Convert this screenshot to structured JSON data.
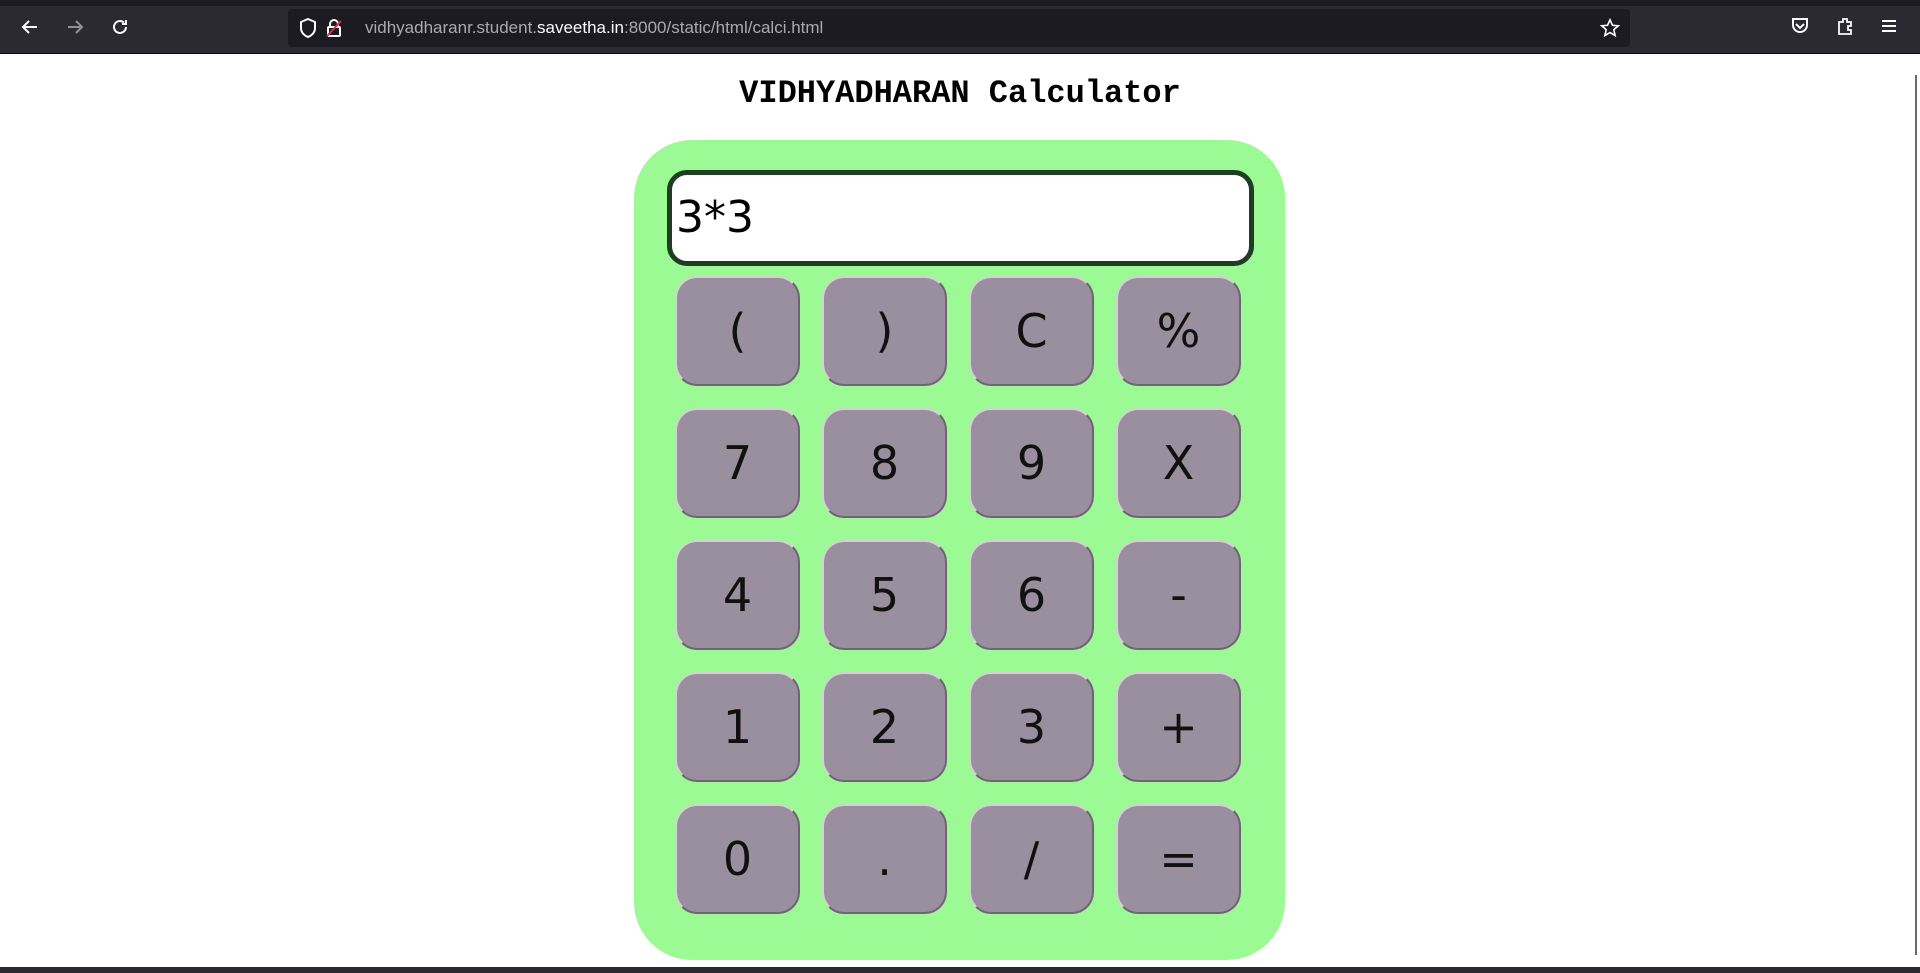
{
  "browser": {
    "url_prefix": "vidhyadharanr.student.",
    "url_host": "saveetha.in",
    "url_suffix": ":8000/static/html/calci.html",
    "icons": [
      "back-icon",
      "forward-icon",
      "reload-icon",
      "shield-icon",
      "lock-icon",
      "bookmark-star-icon",
      "pocket-icon",
      "extensions-icon",
      "menu-icon"
    ]
  },
  "page": {
    "title": "VIDHYADHARAN Calculator"
  },
  "calculator": {
    "display_value": "3*3",
    "colors": {
      "body": "#9cfa94",
      "key": "#9a8f9e",
      "display_border": "#1e3d22"
    },
    "keys": [
      [
        "(",
        ")",
        "C",
        "%"
      ],
      [
        "7",
        "8",
        "9",
        "X"
      ],
      [
        "4",
        "5",
        "6",
        "-"
      ],
      [
        "1",
        "2",
        "3",
        "+"
      ],
      [
        "0",
        ".",
        "/",
        "="
      ]
    ]
  }
}
